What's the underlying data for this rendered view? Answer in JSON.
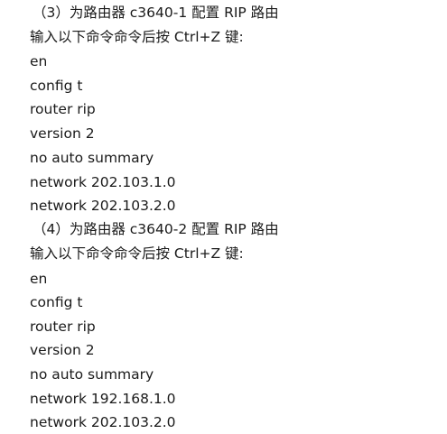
{
  "sections": [
    {
      "heading": "（3）为路由器 c3640-1 配置 RIP 路由",
      "instruction": "输入以下命令命令后按 Ctrl+Z 键:",
      "commands": [
        "en",
        "config t",
        "router rip",
        "version 2",
        "no auto summary",
        "network 202.103.1.0",
        "network 202.103.2.0"
      ]
    },
    {
      "heading": "（4）为路由器 c3640-2 配置 RIP 路由",
      "instruction": "输入以下命令命令后按 Ctrl+Z 键:",
      "commands": [
        "en",
        "config t",
        "router rip",
        "version 2",
        "no auto summary",
        "network 192.168.1.0",
        "network 202.103.2.0"
      ]
    }
  ]
}
